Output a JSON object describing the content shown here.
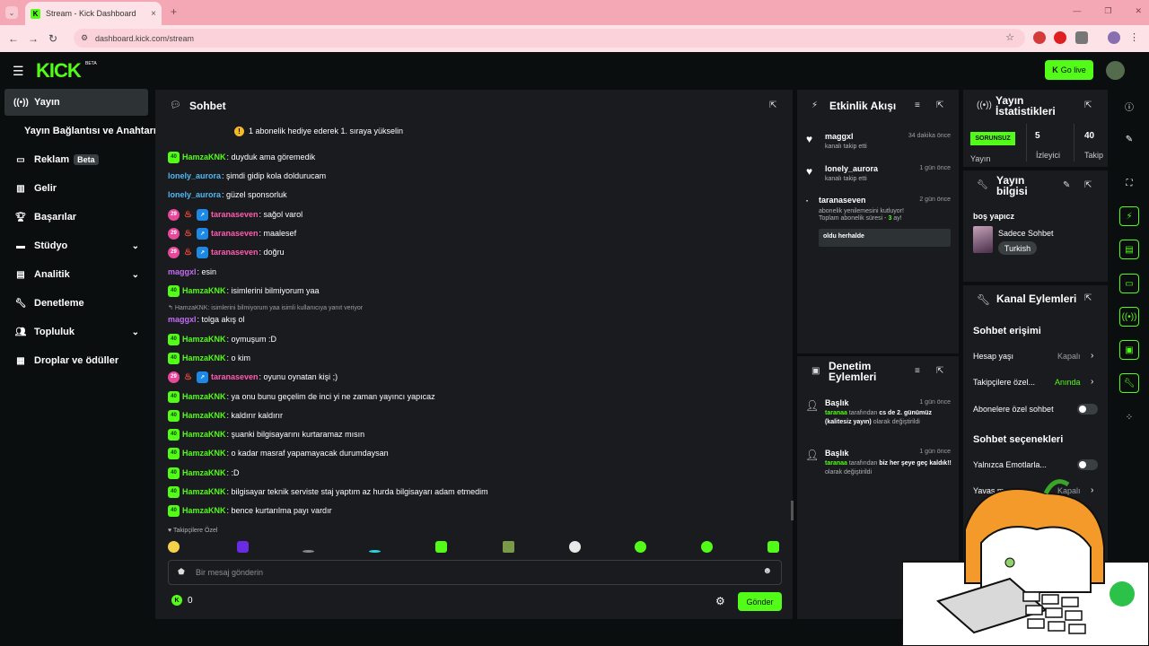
{
  "browser": {
    "tab_title": "Stream - Kick Dashboard",
    "tab_close": "×",
    "new_tab": "+",
    "url": "dashboard.kick.com/stream"
  },
  "header": {
    "logo": "KICK",
    "logo_badge": "BETA",
    "go_live": "Go live"
  },
  "sidebar": {
    "items": [
      {
        "label": "Yayın",
        "icon": "broadcast-icon"
      },
      {
        "label": "Yayın Bağlantısı ve Anahtarı",
        "icon": ""
      },
      {
        "label": "Reklam",
        "icon": "ad-icon",
        "badge": "Beta"
      },
      {
        "label": "Gelir",
        "icon": "chart-icon"
      },
      {
        "label": "Başarılar",
        "icon": "trophy-icon"
      },
      {
        "label": "Stüdyo",
        "icon": "studio-icon"
      },
      {
        "label": "Analitik",
        "icon": "analytics-icon"
      },
      {
        "label": "Denetleme",
        "icon": "wrench-icon"
      },
      {
        "label": "Topluluk",
        "icon": "community-icon"
      },
      {
        "label": "Droplar ve ödüller",
        "icon": "drops-icon"
      }
    ]
  },
  "chat": {
    "title": "Sohbet",
    "pinned": "1 abonelik hediye ederek 1. sıraya yükselin",
    "messages": [
      {
        "user": "HamzaKNK",
        "text": ": duyduk ama göremedik"
      },
      {
        "user": "lonely_aurora",
        "text": ": şimdi gidip kola doldurucam"
      },
      {
        "user": "lonely_aurora",
        "text": ": güzel sponsorluk"
      },
      {
        "user": "taranaseven",
        "text": ": sağol varol"
      },
      {
        "user": "taranaseven",
        "text": ": maalesef"
      },
      {
        "user": "taranaseven",
        "text": ": doğru"
      },
      {
        "user": "maggxl",
        "text": ": esin"
      },
      {
        "user": "HamzaKNK",
        "text": ": isimlerini bilmiyorum yaa"
      },
      {
        "user": "maggxl",
        "text": ": tolga akış ol"
      },
      {
        "user": "HamzaKNK",
        "text": ": oymuşum :D"
      },
      {
        "user": "HamzaKNK",
        "text": ": o kim"
      },
      {
        "user": "taranaseven",
        "text": ": oyunu oynatan kişi ;)"
      },
      {
        "user": "HamzaKNK",
        "text": ": ya onu bunu geçelim de inci yi ne zaman yayıncı yapıcaz"
      },
      {
        "user": "HamzaKNK",
        "text": ": kaldırır kaldırır"
      },
      {
        "user": "HamzaKNK",
        "text": ": şuanki bilgisayarını kurtaramaz mısın"
      },
      {
        "user": "HamzaKNK",
        "text": ": o kadar masraf yapamayacak durumdaysan"
      },
      {
        "user": "HamzaKNK",
        "text": ": :D"
      },
      {
        "user": "HamzaKNK",
        "text": ": bilgisayar teknik serviste staj yaptım az hurda bilgisayarı adam etmedim"
      },
      {
        "user": "HamzaKNK",
        "text": ": bence kurtarılma payı vardır"
      }
    ],
    "reply_note": "HamzaKNK: isimlerini bilmiyorum yaa isimli kullanıcıya yanıt veriyor",
    "badge_sub": "40",
    "badge_sub2": "29",
    "followers_only": "Takipçilere Özel",
    "input_placeholder": "Bir mesaj gönderin",
    "kick_count": "0",
    "send": "Gönder"
  },
  "activity": {
    "title": "Etkinlik Akışı",
    "events": [
      {
        "user": "maggxl",
        "action": "kanalı takip etti",
        "time": "34 dakika önce"
      },
      {
        "user": "lonely_aurora",
        "action": "kanalı takip etti",
        "time": "1 gün önce"
      },
      {
        "user": "taranaseven",
        "time": "2 gün önce",
        "line1": "abonelik yenilemesini kutluyor!",
        "line2_a": "Toplam abonelik süresi - ",
        "line2_n": "3",
        "line2_b": " ay!",
        "message": "oldu herhalde"
      }
    ]
  },
  "moderation": {
    "title": "Denetim Eylemleri",
    "events": [
      {
        "heading": "Başlık",
        "time": "1 gün önce",
        "actor": "taranaa",
        "by": " tarafından ",
        "value": "cs de 2. günümüz (kalitesiz yayın)",
        "suffix": " olarak değiştirildi"
      },
      {
        "heading": "Başlık",
        "time": "1 gün önce",
        "actor": "taranaa",
        "by": " tarafından ",
        "value": "biz her şeye geç kaldık!!",
        "suffix": " olarak değiştirildi"
      }
    ]
  },
  "stats": {
    "title": "Yayın İstatistikleri",
    "status": "SORUNSUZ",
    "status_label": "Yayın",
    "viewers": "5",
    "viewers_label": "İzleyici",
    "followers": "40",
    "followers_label": "Takip"
  },
  "info": {
    "title": "Yayın bilgisi",
    "stream_title": "boş yapıcz",
    "category": "Sadece Sohbet",
    "tag": "Turkish"
  },
  "channel": {
    "title": "Kanal Eylemleri",
    "chat_access": "Sohbet erişimi",
    "account_age": "Hesap yaşı",
    "account_age_val": "Kapalı",
    "followers_only": "Takipçilere özel...",
    "followers_only_val": "Anında",
    "subs_only": "Abonelere özel sohbet",
    "chat_options": "Sohbet seçenekleri",
    "emotes_only": "Yalnızca Emotlarla...",
    "slow_mode": "Yavaş m",
    "slow_val": "Kapalı",
    "last": "Ya"
  },
  "colors": {
    "accent": "#53fc18",
    "panel": "#191b1f",
    "bg": "#0b0e0f"
  }
}
